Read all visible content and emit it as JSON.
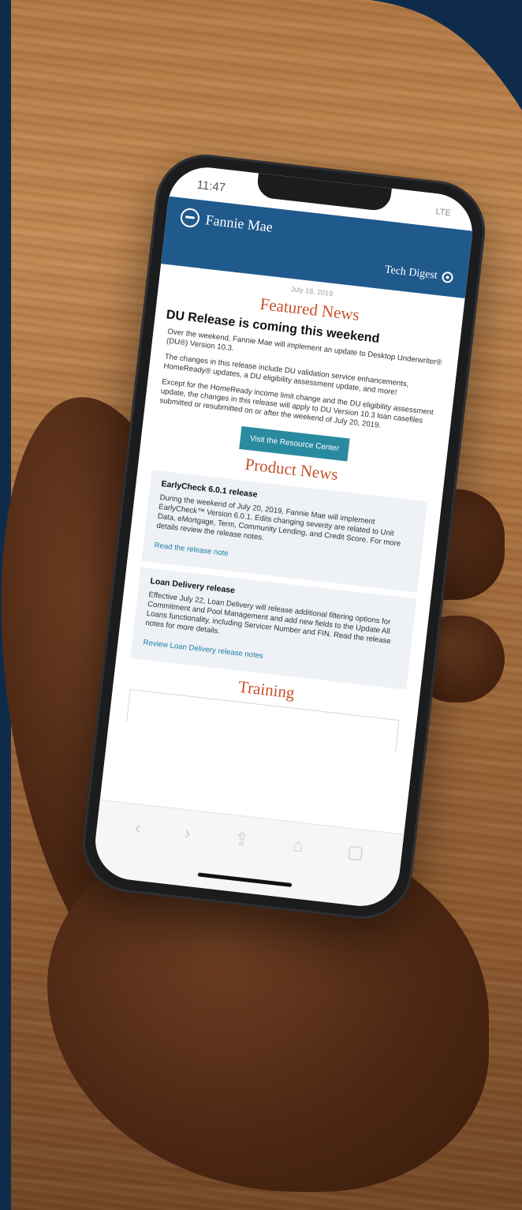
{
  "status_bar": {
    "time": "11:47",
    "network": "LTE"
  },
  "header": {
    "brand": "Fannie Mae",
    "digest": "Tech Digest",
    "logo_icon": "fannie-mae-logo-icon",
    "settings_icon": "gear-icon"
  },
  "date": "July 18, 2019",
  "featured": {
    "section_title": "Featured News",
    "headline": "DU Release is coming this weekend",
    "paragraphs": [
      "Over the weekend, Fannie Mae will implement an update to Desktop Underwriter® (DU®) Version 10.3.",
      "The changes in this release include DU validation service enhancements, HomeReady® updates, a DU eligibility assessment update, and more!",
      "Except for the HomeReady income limit change and the DU eligibility assessment update, the changes in this release will apply to DU Version 10.3 loan casefiles submitted or resubmitted on or after the weekend of July 20, 2019."
    ],
    "cta": "Visit the Resource Center"
  },
  "product": {
    "section_title": "Product News",
    "items": [
      {
        "title": "EarlyCheck 6.0.1 release",
        "body": "During the weekend of July 20, 2019, Fannie Mae will implement EarlyCheck™ Version 6.0.1. Edits changing severity are related to Unit Data, eMortgage, Term, Community Lending, and Credit Score. For more details review the release notes.",
        "link": "Read the release note"
      },
      {
        "title": "Loan Delivery release",
        "body": "Effective July 22, Loan Delivery will release additional filtering options for Commitment and Pool Management and add new fields to the Update All Loans functionality, including Servicer Number and FIN. Read the release notes for more details.",
        "link": "Review Loan Delivery release notes"
      }
    ]
  },
  "training": {
    "section_title": "Training"
  },
  "toolbar": {
    "back": "‹",
    "forward": "›",
    "share": "⇪",
    "bookmarks": "⌂",
    "tabs": "▢"
  },
  "colors": {
    "brand_blue": "#205a8c",
    "section_orange": "#c6512a",
    "cta_teal": "#2a8aa0",
    "corner_navy": "#0e2c4a"
  }
}
